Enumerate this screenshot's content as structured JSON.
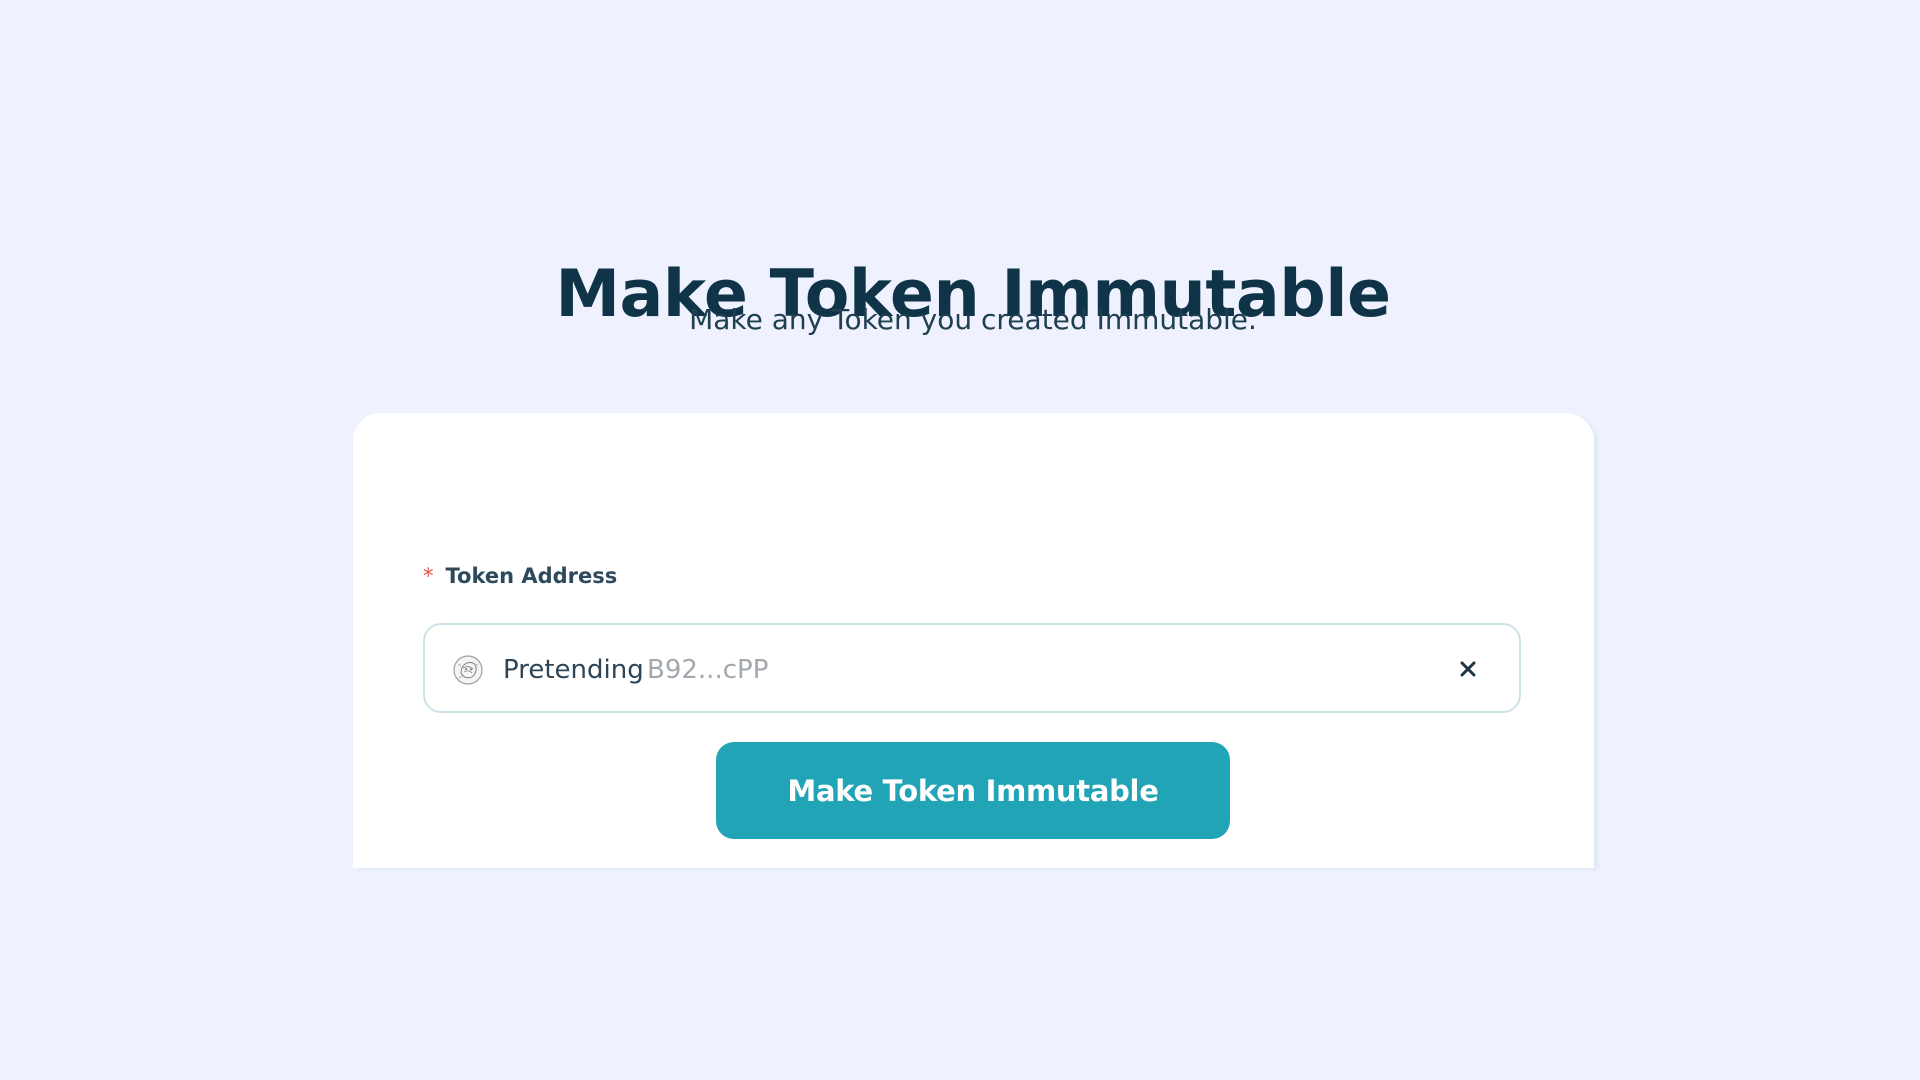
{
  "header": {
    "title": "Make Token Immutable",
    "subtitle": "Make any Token you created Immutable."
  },
  "form": {
    "token_field": {
      "required_marker": "*",
      "label": "Token Address",
      "selected_token": {
        "name": "Pretending",
        "address": "B92...cPP",
        "avatar_icon": "token-avatar-icon"
      },
      "clear_icon": "close-icon"
    },
    "submit_label": "Make Token Immutable"
  },
  "colors": {
    "background": "#eff2fe",
    "card": "#ffffff",
    "title": "#0f3347",
    "accent": "#21a4b5",
    "required": "#e4504c",
    "input_border": "#cfe2e8",
    "address_text": "#a2a8ad"
  }
}
